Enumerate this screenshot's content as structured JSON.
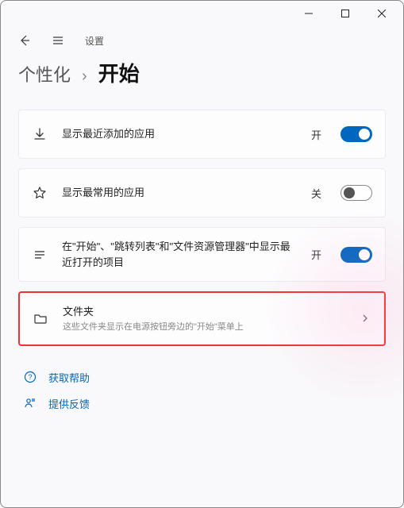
{
  "app_title": "设置",
  "breadcrumb": {
    "parent": "个性化",
    "current": "开始"
  },
  "settings": [
    {
      "icon": "download",
      "title": "显示最近添加的应用",
      "subtitle": "",
      "state_label": "开",
      "toggle": "on",
      "has_chevron": false,
      "highlight": false
    },
    {
      "icon": "star",
      "title": "显示最常用的应用",
      "subtitle": "",
      "state_label": "关",
      "toggle": "off",
      "has_chevron": false,
      "highlight": false
    },
    {
      "icon": "list",
      "title": "在\"开始\"、\"跳转列表\"和\"文件资源管理器\"中显示最近打开的项目",
      "subtitle": "",
      "state_label": "开",
      "toggle": "on",
      "has_chevron": false,
      "highlight": false
    },
    {
      "icon": "folder",
      "title": "文件夹",
      "subtitle": "这些文件夹显示在电源按钮旁边的\"开始\"菜单上",
      "state_label": "",
      "toggle": "",
      "has_chevron": true,
      "highlight": true
    }
  ],
  "footer": {
    "help": "获取帮助",
    "feedback": "提供反馈"
  }
}
